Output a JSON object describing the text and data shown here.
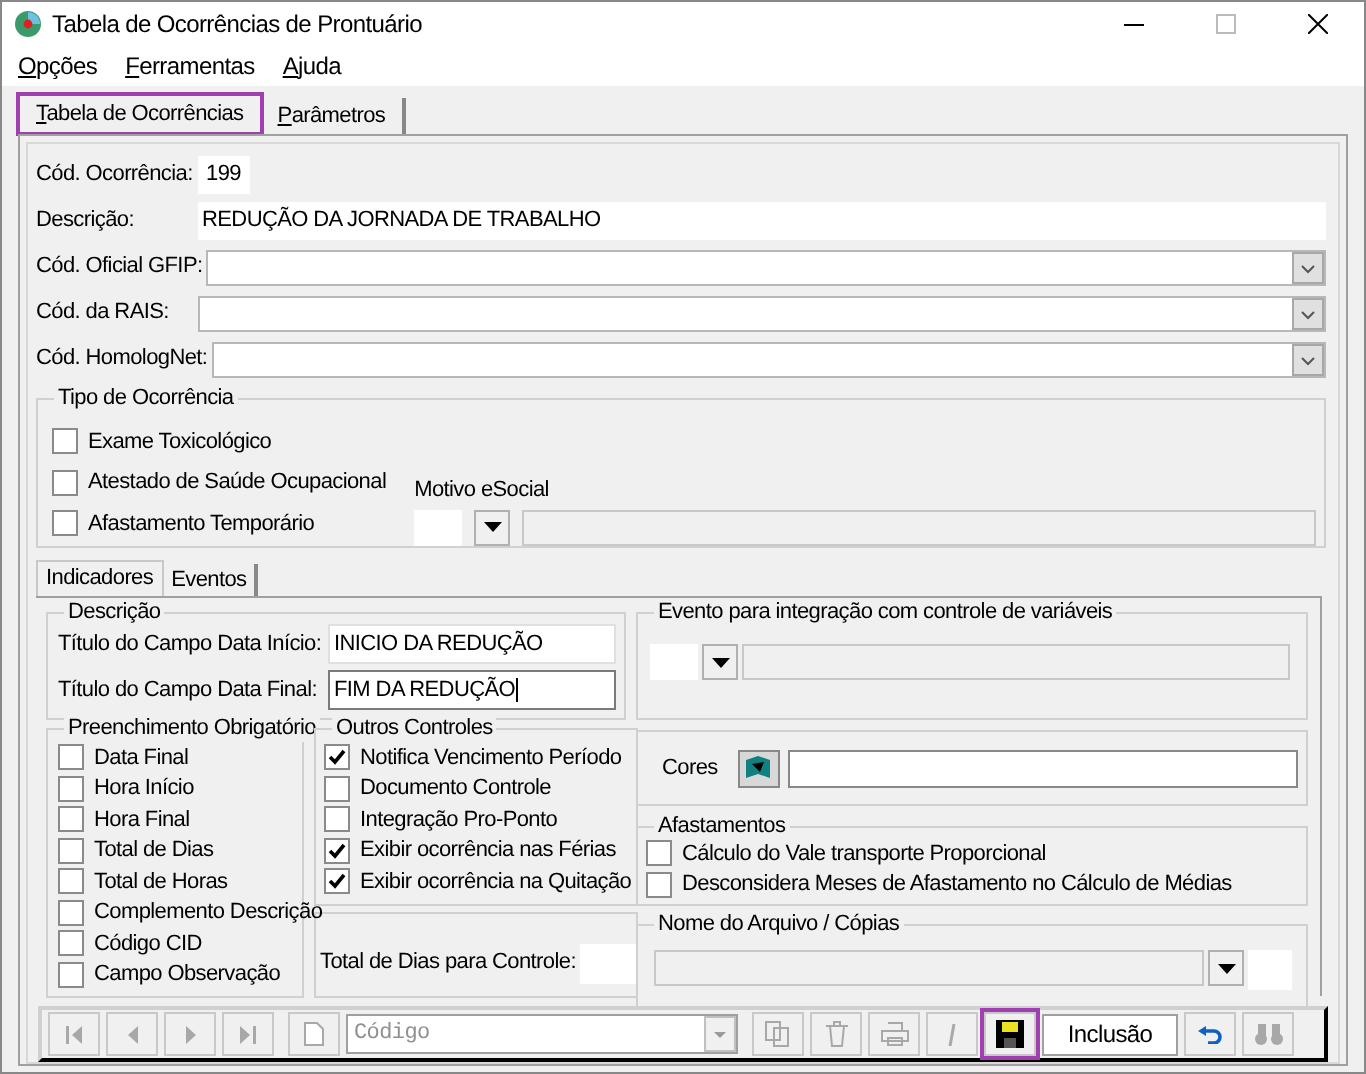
{
  "window": {
    "title": "Tabela de Ocorrências de Prontuário"
  },
  "menu": [
    {
      "label": "Opções"
    },
    {
      "label": "Ferramentas"
    },
    {
      "label": "Ajuda"
    }
  ],
  "tabs": [
    {
      "label": "Tabela de Ocorrências",
      "selected": true,
      "highlighted": true
    },
    {
      "label": "Parâmetros",
      "selected": false,
      "highlighted": false
    }
  ],
  "fields": [
    {
      "label": "Cód. Ocorrência:",
      "value": "199",
      "kind": "short"
    },
    {
      "label": "Descrição:",
      "value": "REDUÇÃO DA JORNADA DE TRABALHO",
      "kind": "text"
    },
    {
      "label": "Cód. Oficial GFIP:",
      "kind": "combo"
    },
    {
      "label": "Cód. da RAIS:",
      "kind": "combo"
    },
    {
      "label": "Cód. HomologNet:",
      "kind": "combo"
    }
  ],
  "tipo_ocorrencia": {
    "title": "Tipo de Ocorrência",
    "motivo_label": "Motivo eSocial",
    "items": [
      {
        "label": "Exame Toxicológico",
        "checked": false
      },
      {
        "label": "Atestado de Saúde Ocupacional",
        "checked": false
      },
      {
        "label": "Afastamento Temporário",
        "checked": false
      }
    ]
  },
  "subtabs": [
    {
      "label": "Indicadores",
      "selected": true
    },
    {
      "label": "Eventos",
      "selected": false
    }
  ],
  "descricao": {
    "title": "Descrição",
    "rows": [
      {
        "label": "Título do Campo Data Início:",
        "value": "INICIO DA REDUÇÃO",
        "focused": false
      },
      {
        "label": "Título do Campo Data Final:",
        "value": "FIM DA REDUÇÃO",
        "focused": true
      }
    ]
  },
  "evento": {
    "title": "Evento para integração com controle de variáveis"
  },
  "preenchimento": {
    "title": "Preenchimento Obrigatório",
    "items": [
      {
        "label": "Data Final",
        "checked": false
      },
      {
        "label": "Hora Início",
        "checked": false
      },
      {
        "label": "Hora Final",
        "checked": false
      },
      {
        "label": "Total de Dias",
        "checked": false
      },
      {
        "label": "Total de Horas",
        "checked": false
      },
      {
        "label": "Complemento Descrição",
        "checked": false
      },
      {
        "label": "Código CID",
        "checked": false
      },
      {
        "label": "Campo Observação",
        "checked": false
      }
    ]
  },
  "outros": {
    "title": "Outros Controles",
    "items": [
      {
        "label": "Notifica Vencimento Período",
        "checked": true
      },
      {
        "label": "Documento Controle",
        "checked": false
      },
      {
        "label": "Integração Pro-Ponto",
        "checked": false
      },
      {
        "label": "Exibir ocorrência nas Férias",
        "checked": true
      },
      {
        "label": "Exibir ocorrência na Quitação",
        "checked": true
      }
    ]
  },
  "total_dias": {
    "label": "Total de Dias para Controle:"
  },
  "cores": {
    "label": "Cores"
  },
  "afastamentos": {
    "title": "Afastamentos",
    "items": [
      {
        "label": "Cálculo do Vale transporte Proporcional",
        "checked": false
      },
      {
        "label": "Desconsidera Meses de Afastamento no Cálculo de Médias",
        "checked": false
      }
    ]
  },
  "nome_arquivo": {
    "title": "Nome do Arquivo / Cópias"
  },
  "toolbar": {
    "code_placeholder": "Código",
    "mode": "Inclusão",
    "buttons": [
      {
        "kind": "first",
        "disabled": true
      },
      {
        "kind": "prev",
        "disabled": true
      },
      {
        "kind": "next",
        "disabled": true
      },
      {
        "kind": "last",
        "disabled": true
      },
      {
        "kind": "new",
        "disabled": true
      },
      {
        "kind": "code"
      },
      {
        "kind": "copy",
        "disabled": true
      },
      {
        "kind": "delete",
        "disabled": true
      },
      {
        "kind": "print",
        "disabled": true
      },
      {
        "kind": "italic",
        "disabled": true
      },
      {
        "kind": "save",
        "disabled": false,
        "highlighted": true
      },
      {
        "kind": "mode"
      },
      {
        "kind": "undo",
        "disabled": false
      },
      {
        "kind": "find",
        "disabled": true
      }
    ]
  }
}
